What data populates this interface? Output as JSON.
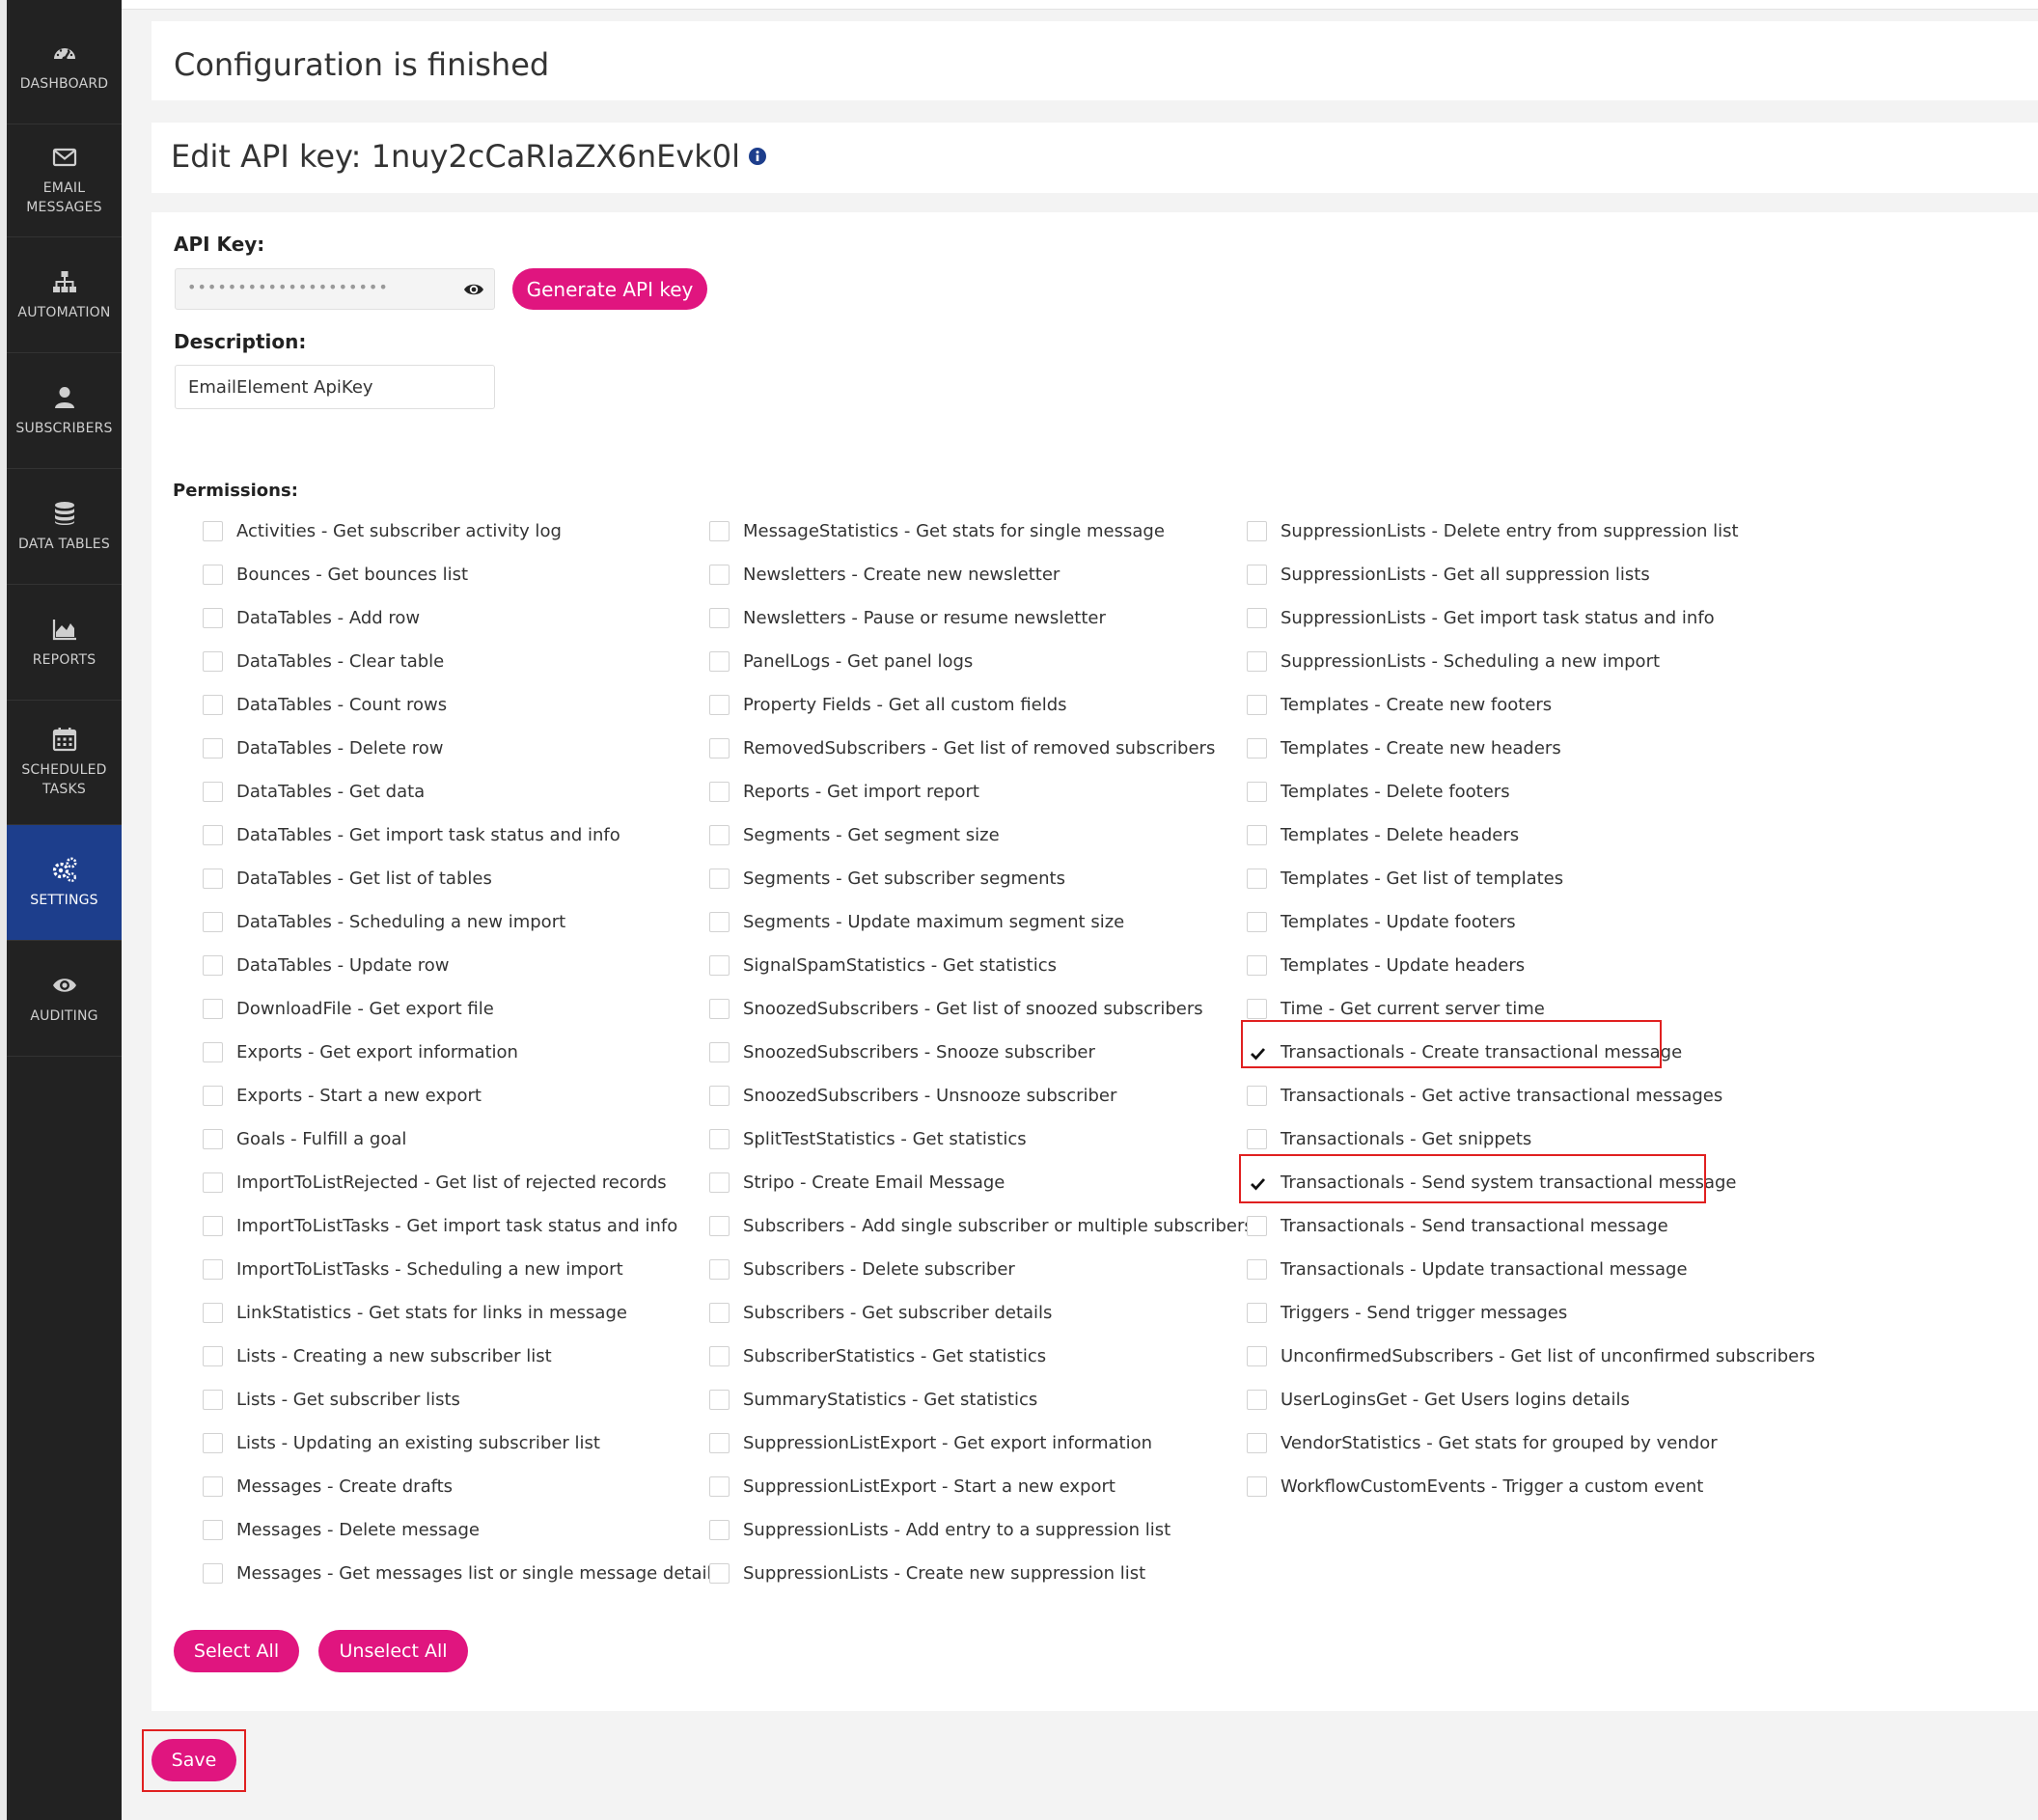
{
  "sidebar": {
    "items": [
      {
        "label": "DASHBOARD",
        "icon": "dashboard-icon"
      },
      {
        "label": "EMAIL\nMESSAGES",
        "icon": "envelope-icon"
      },
      {
        "label": "AUTOMATION",
        "icon": "sitemap-icon"
      },
      {
        "label": "SUBSCRIBERS",
        "icon": "user-icon"
      },
      {
        "label": "DATA TABLES",
        "icon": "database-icon"
      },
      {
        "label": "REPORTS",
        "icon": "area-chart-icon"
      },
      {
        "label": "SCHEDULED\nTASKS",
        "icon": "calendar-icon"
      },
      {
        "label": "SETTINGS",
        "icon": "gears-icon",
        "active": true
      },
      {
        "label": "AUDITING",
        "icon": "eye-icon"
      }
    ]
  },
  "config": {
    "title": "Configuration is finished"
  },
  "edit": {
    "title": "Edit API key: 1nuy2cCaRIaZX6nEvk0l"
  },
  "form": {
    "api_key_label": "API Key:",
    "api_key_masked": "••••••••••••••••••••",
    "generate_label": "Generate API key",
    "description_label": "Description:",
    "description_value": "EmailElement ApiKey",
    "permissions_label": "Permissions:"
  },
  "permissions": {
    "col1": [
      "Activities - Get subscriber activity log",
      "Bounces - Get bounces list",
      "DataTables - Add row",
      "DataTables - Clear table",
      "DataTables - Count rows",
      "DataTables - Delete row",
      "DataTables - Get data",
      "DataTables - Get import task status and info",
      "DataTables - Get list of tables",
      "DataTables - Scheduling a new import",
      "DataTables - Update row",
      "DownloadFile - Get export file",
      "Exports - Get export information",
      "Exports - Start a new export",
      "Goals - Fulfill a goal",
      "ImportToListRejected - Get list of rejected records",
      "ImportToListTasks - Get import task status and info",
      "ImportToListTasks - Scheduling a new import",
      "LinkStatistics - Get stats for links in message",
      "Lists - Creating a new subscriber list",
      "Lists - Get subscriber lists",
      "Lists - Updating an existing subscriber list",
      "Messages - Create drafts",
      "Messages - Delete message",
      "Messages - Get messages list or single message details"
    ],
    "col2": [
      "MessageStatistics - Get stats for single message",
      "Newsletters - Create new newsletter",
      "Newsletters - Pause or resume newsletter",
      "PanelLogs - Get panel logs",
      "Property Fields - Get all custom fields",
      "RemovedSubscribers - Get list of removed subscribers",
      "Reports - Get import report",
      "Segments - Get segment size",
      "Segments - Get subscriber segments",
      "Segments - Update maximum segment size",
      "SignalSpamStatistics - Get statistics",
      "SnoozedSubscribers - Get list of snoozed subscribers",
      "SnoozedSubscribers - Snooze subscriber",
      "SnoozedSubscribers - Unsnooze subscriber",
      "SplitTestStatistics - Get statistics",
      "Stripo - Create Email Message",
      "Subscribers - Add single subscriber or multiple subscribers",
      "Subscribers - Delete subscriber",
      "Subscribers - Get subscriber details",
      "SubscriberStatistics - Get statistics",
      "SummaryStatistics - Get statistics",
      "SuppressionListExport - Get export information",
      "SuppressionListExport - Start a new export",
      "SuppressionLists - Add entry to a suppression list",
      "SuppressionLists - Create new suppression list"
    ],
    "col3": [
      "SuppressionLists - Delete entry from suppression list",
      "SuppressionLists - Get all suppression lists",
      "SuppressionLists - Get import task status and info",
      "SuppressionLists - Scheduling a new import",
      "Templates - Create new footers",
      "Templates - Create new headers",
      "Templates - Delete footers",
      "Templates - Delete headers",
      "Templates - Get list of templates",
      "Templates - Update footers",
      "Templates - Update headers",
      "Time - Get current server time",
      "Transactionals - Create transactional message",
      "Transactionals - Get active transactional messages",
      "Transactionals - Get snippets",
      "Transactionals - Send system transactional message",
      "Transactionals - Send transactional message",
      "Transactionals - Update transactional message",
      "Triggers - Send trigger messages",
      "UnconfirmedSubscribers - Get list of unconfirmed subscribers",
      "UserLoginsGet - Get Users logins details",
      "VendorStatistics - Get stats for grouped by vendor",
      "WorkflowCustomEvents - Trigger a custom event"
    ],
    "checked_col3": [
      12,
      15
    ]
  },
  "actions": {
    "select_all": "Select All",
    "unselect_all": "Unselect All",
    "save": "Save"
  },
  "colors": {
    "accent": "#e0157f",
    "sidebar_bg": "#222222",
    "sidebar_active": "#1d3e8c",
    "highlight": "#e02020"
  }
}
